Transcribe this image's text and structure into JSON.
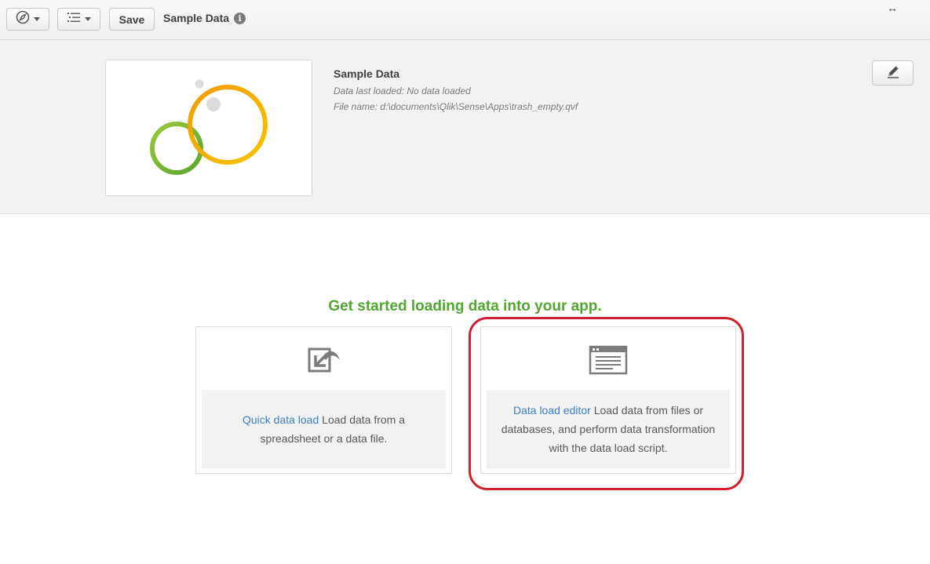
{
  "toolbar": {
    "nav_icon": "compass-icon",
    "menu_icon": "list-icon",
    "save_label": "Save",
    "app_title": "Sample Data",
    "info_icon": "info-icon",
    "resize_glyph": "↔"
  },
  "app": {
    "name": "Sample Data",
    "last_loaded": "Data last loaded: No data loaded",
    "file_name": "File name: d:\\documents\\Qlik\\Sense\\Apps\\trash_empty.qvf",
    "edit_icon": "pencil-icon"
  },
  "get_started": {
    "headline": "Get started loading data into your app.",
    "cards": [
      {
        "icon": "import-icon",
        "link": "Quick data load",
        "text": "Load data from a spreadsheet or a data file."
      },
      {
        "icon": "script-editor-icon",
        "link": "Data load editor",
        "text": "Load data from files or databases, and perform data transformation with the data load script."
      }
    ]
  },
  "colors": {
    "accent_green": "#52a632",
    "link_blue": "#3b7fc4",
    "highlight_red": "#d0202e",
    "circle_orange": "#f3a800",
    "circle_green": "#8cc63f"
  }
}
